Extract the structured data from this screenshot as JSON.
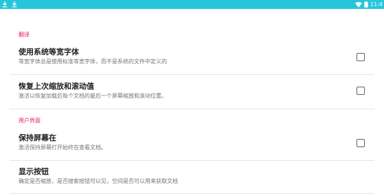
{
  "status_bar": {
    "time": "11:4",
    "left_icons": [
      "download-icon",
      "download-icon"
    ],
    "right_icons": [
      "wifi-icon",
      "battery-icon"
    ],
    "color": "#26c6da"
  },
  "sections": [
    {
      "header": "翻译",
      "items": [
        {
          "title": "使用系统等宽字体",
          "summary": "等宽字体总是使用标准等宽字体，而不是系统的文件中定义的",
          "checked": false
        },
        {
          "title": "恢复上次缩放和滚动值",
          "summary": "激活以恢复加载后每个文档的最后一个屏幕缩放和滚动位置。",
          "checked": false
        }
      ]
    },
    {
      "header": "用户界面",
      "items": [
        {
          "title": "保持屏幕在",
          "summary": "激活保持屏幕打开始终在查看文档。",
          "checked": false
        },
        {
          "title": "显示按钮",
          "summary": "确定是否缩放，是否搜索按钮可以见，空间是否可以用来获取文档"
        }
      ]
    }
  ],
  "colors": {
    "accent": "#e91e63",
    "title": "#212121",
    "summary": "#757575",
    "divider": "#e6e6e6"
  }
}
